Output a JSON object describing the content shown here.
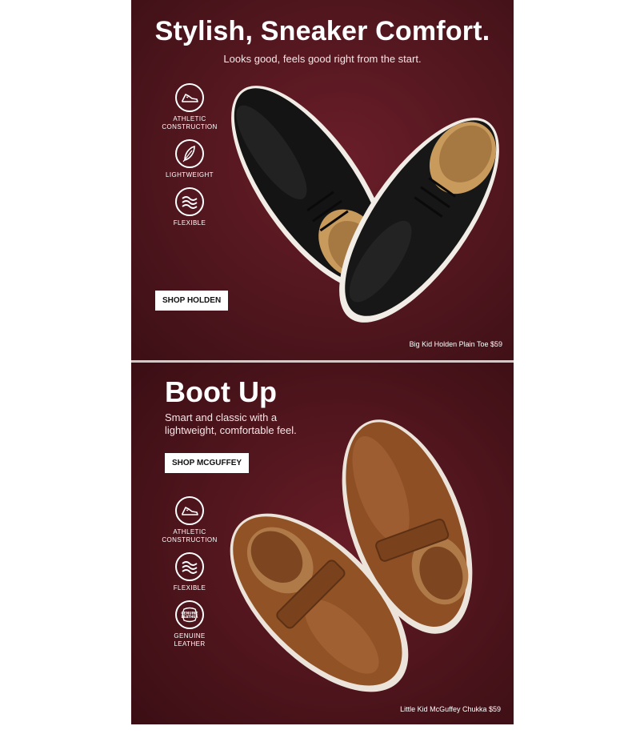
{
  "promo_holden": {
    "headline": "Stylish, Sneaker Comfort.",
    "subhead": "Looks good, feels good right from the start.",
    "features": [
      {
        "icon": "sneaker-icon",
        "label": "ATHLETIC CONSTRUCTION"
      },
      {
        "icon": "feather-icon",
        "label": "LIGHTWEIGHT"
      },
      {
        "icon": "wave-icon",
        "label": "FLEXIBLE"
      }
    ],
    "cta_label": "SHOP HOLDEN",
    "caption": "Big Kid Holden Plain Toe $59"
  },
  "promo_mcguffey": {
    "headline": "Boot Up",
    "subhead": "Smart and classic with a lightweight, comfortable feel.",
    "features": [
      {
        "icon": "sneaker-icon",
        "label": "ATHLETIC CONSTRUCTION"
      },
      {
        "icon": "wave-icon",
        "label": "FLEXIBLE"
      },
      {
        "icon": "genuine-leather-icon",
        "label": "GENUINE LEATHER",
        "badge_text": "GENUINE LEATHER"
      }
    ],
    "cta_label": "SHOP MCGUFFEY",
    "caption": "Little Kid McGuffey Chukka $59"
  },
  "colors": {
    "panel_bg": "#5e1a23",
    "panel_bg_dark": "#3c0f15",
    "cta_bg": "#ffffff",
    "text": "#ffffff"
  }
}
